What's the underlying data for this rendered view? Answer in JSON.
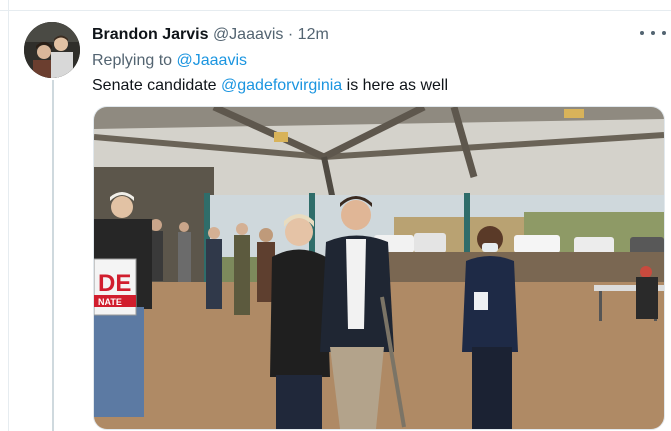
{
  "tweet": {
    "display_name": "Brandon Jarvis",
    "handle": "@Jaaavis",
    "separator": "·",
    "timestamp": "12m",
    "reply_prefix": "Replying to",
    "reply_to": "@Jaaavis",
    "text_before": "Senate candidate",
    "text_mention": "@gadeforvirginia",
    "text_after": "is here as well"
  },
  "photo": {
    "sign_text_big": "DE",
    "sign_text_small": "NATE"
  },
  "colors": {
    "link": "#1b95e0",
    "secondary": "#536471",
    "primary": "#0f1419"
  }
}
